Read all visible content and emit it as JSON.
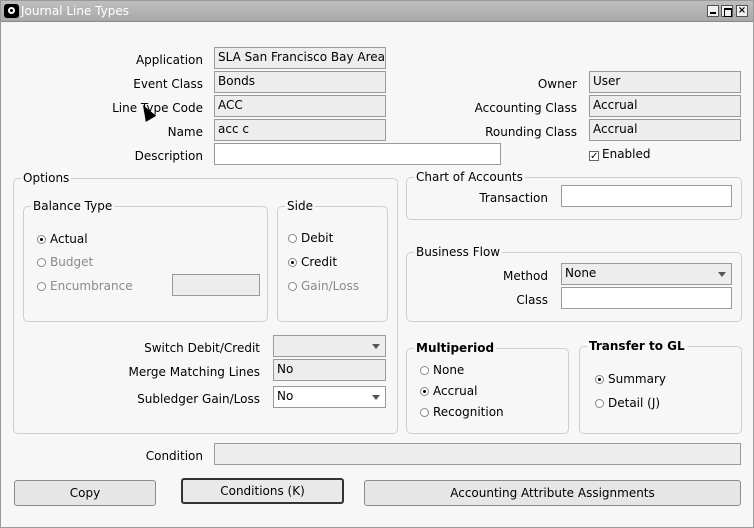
{
  "window": {
    "title": "Journal Line Types"
  },
  "header": {
    "application": {
      "label": "Application",
      "value": "SLA San Francisco Bay Area"
    },
    "event_class": {
      "label": "Event Class",
      "value": "Bonds"
    },
    "line_type_code": {
      "label": "Line Type Code",
      "value": "ACC"
    },
    "name": {
      "label": "Name",
      "value": "acc c"
    },
    "description": {
      "label": "Description",
      "value": ""
    },
    "owner": {
      "label": "Owner",
      "value": "User"
    },
    "accounting_class": {
      "label": "Accounting Class",
      "value": "Accrual"
    },
    "rounding_class": {
      "label": "Rounding Class",
      "value": "Accrual"
    },
    "enabled": {
      "label": "Enabled",
      "checked": true
    }
  },
  "options": {
    "title": "Options",
    "balance_type": {
      "title": "Balance Type",
      "actual": "Actual",
      "budget": "Budget",
      "encumbrance": "Encumbrance",
      "encumbrance_value": ""
    },
    "side": {
      "title": "Side",
      "debit": "Debit",
      "credit": "Credit",
      "gain_loss": "Gain/Loss"
    },
    "switch_debit_credit": {
      "label": "Switch Debit/Credit",
      "value": ""
    },
    "merge_matching_lines": {
      "label": "Merge Matching Lines",
      "value": "No"
    },
    "subledger_gain_loss": {
      "label": "Subledger Gain/Loss",
      "value": "No"
    }
  },
  "chart_of_accounts": {
    "title": "Chart of Accounts",
    "transaction_label": "Transaction",
    "transaction_value": ""
  },
  "business_flow": {
    "title": "Business Flow",
    "method_label": "Method",
    "method_value": "None",
    "class_label": "Class",
    "class_value": ""
  },
  "multiperiod": {
    "title": "Multiperiod",
    "none": "None",
    "accrual": "Accrual",
    "recognition": "Recognition"
  },
  "transfer_to_gl": {
    "title": "Transfer to GL",
    "summary": "Summary",
    "detail": "Detail (J)"
  },
  "condition": {
    "label": "Condition",
    "value": ""
  },
  "buttons": {
    "copy": "Copy",
    "conditions": "Conditions (K)",
    "accounting_attribute_assignments": "Accounting Attribute Assignments"
  }
}
